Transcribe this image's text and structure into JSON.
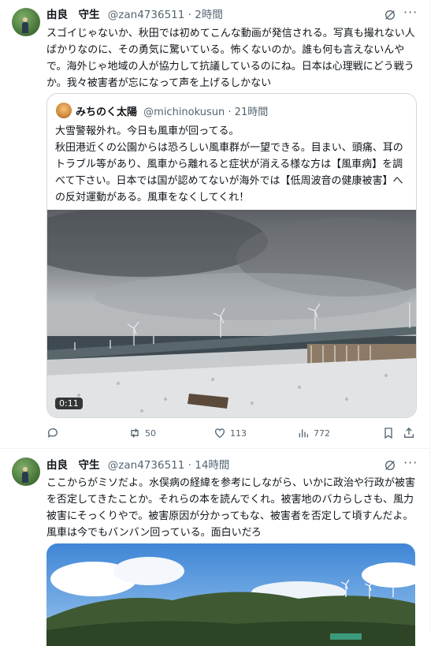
{
  "tweets": [
    {
      "author_name": "由良　守生",
      "handle": "@zan4736511",
      "time": "2時間",
      "text": "スゴイじゃないか、秋田では初めてこんな動画が発信される。写真も撮れない人ばかりなのに、その勇気に驚いている。怖くないのか。誰も何も言えないんやで。海外じゃ地域の人が協力して抗議しているのにね。日本は心理戦にどう戦うか。我々被害者が忘になって声を上げるしかない",
      "quote": {
        "author_name": "みちのく太陽",
        "handle": "@michinokusun",
        "time": "21時間",
        "text": "大雪警報外れ。今日も風車が回ってる。\n秋田港近くの公園からは恐ろしい風車群が一望できる。目まい、頭痛、耳のトラブル等があり、風車から離れると症状が消える様な方は【風車病】を調べて下さい。日本では国が認めてないが海外では【低周波音の健康被害】への反対運動がある。風車をなくしてくれ！",
        "video_duration": "0:11"
      },
      "actions": {
        "retweets": "50",
        "likes": "113",
        "views": "772"
      }
    },
    {
      "author_name": "由良　守生",
      "handle": "@zan4736511",
      "time": "14時間",
      "text": "ここからがミソだよ。水俣病の経緯を参考にしながら、いかに政治や行政が被害を否定してきたことか。それらの本を読んでくれ。被害地のバカらしさも、風力被害にそっくりやで。被害原因が分かってもな、被害者を否定して頃すんだよ。風車は今でもバンバン回っている。面白いだろ"
    }
  ],
  "icons": {
    "grok": "grok-icon",
    "more": "more-icon",
    "reply": "reply-icon",
    "retweet": "retweet-icon",
    "like": "heart-icon",
    "views": "views-icon",
    "bookmark": "bookmark-icon",
    "share": "share-icon"
  },
  "colors": {
    "text": "#0f1419",
    "secondary": "#536471",
    "border": "#cfd9de"
  }
}
